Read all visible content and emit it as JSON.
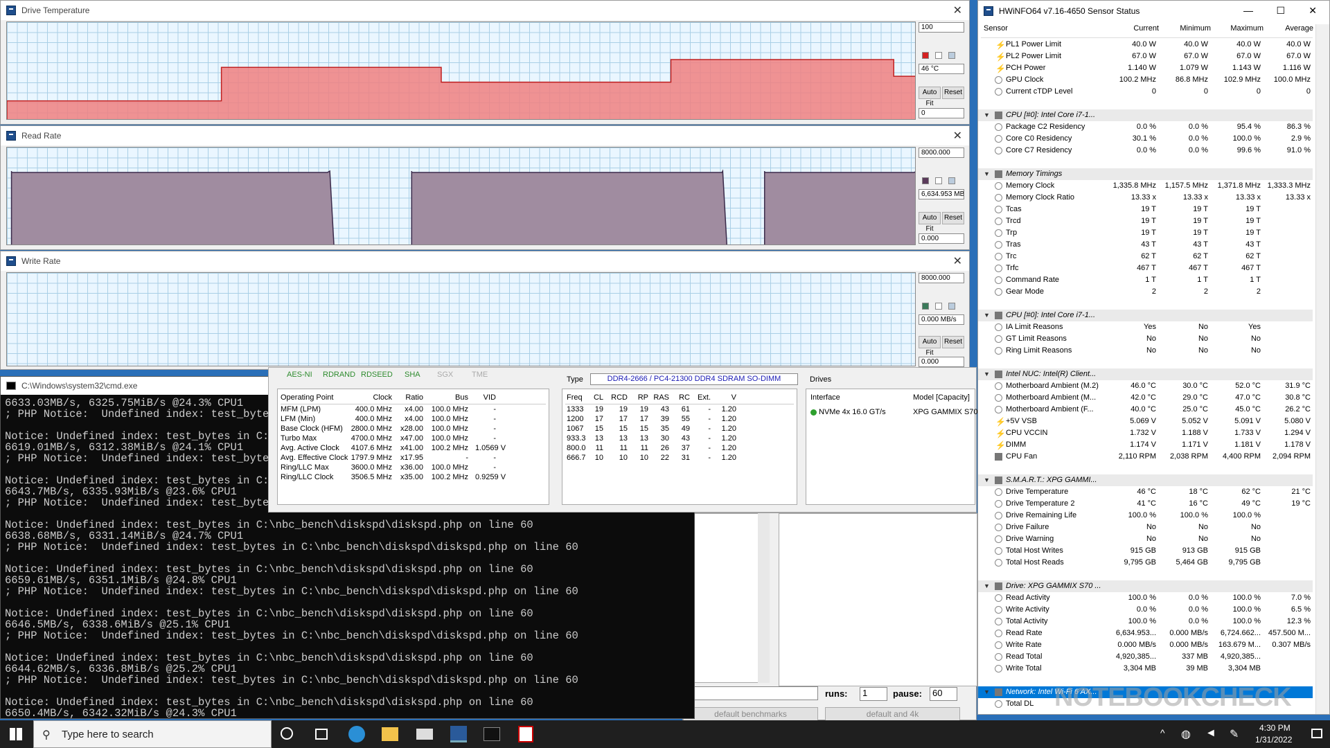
{
  "graphs": [
    {
      "title": "Drive Temperature",
      "max": "100",
      "current": "46 °C",
      "min": "0",
      "autofit": "Auto Fit",
      "reset": "Reset",
      "color": "#f08080",
      "legend_color": "#d42020",
      "points": [
        [
          0,
          0.2
        ],
        [
          0.283,
          0.2
        ],
        [
          0.283,
          0.54
        ],
        [
          0.573,
          0.54
        ],
        [
          0.573,
          0.39
        ],
        [
          0.876,
          0.39
        ],
        [
          0.876,
          0.62
        ],
        [
          1.17,
          0.62
        ],
        [
          1.17,
          0.45
        ],
        [
          1.2,
          0.45
        ]
      ]
    },
    {
      "title": "Read Rate",
      "max": "8000.000",
      "current": "6,634.953 MB",
      "min": "0.000",
      "autofit": "Auto Fit",
      "reset": "Reset",
      "color": "#a08ca0",
      "legend_color": "#5a3a5a"
    },
    {
      "title": "Write Rate",
      "max": "8000.000",
      "current": "0.000 MB/s",
      "min": "0.000",
      "autofit": "Auto Fit",
      "reset": "Reset",
      "color": "#e0f0ff",
      "legend_color": "#3a7a5a"
    }
  ],
  "hwinfo": {
    "title": "HWiNFO64 v7.16-4650 Sensor Status",
    "headers": [
      "Sensor",
      "Current",
      "Minimum",
      "Maximum",
      "Average"
    ],
    "rows": [
      {
        "t": "bolt",
        "n": "PL1 Power Limit",
        "v": [
          "40.0 W",
          "40.0 W",
          "40.0 W",
          "40.0 W"
        ]
      },
      {
        "t": "bolt",
        "n": "PL2 Power Limit",
        "v": [
          "67.0 W",
          "67.0 W",
          "67.0 W",
          "67.0 W"
        ]
      },
      {
        "t": "bolt",
        "n": "PCH Power",
        "v": [
          "1.140 W",
          "1.079 W",
          "1.143 W",
          "1.116 W"
        ]
      },
      {
        "t": "r",
        "n": "GPU Clock",
        "v": [
          "100.2 MHz",
          "86.8 MHz",
          "102.9 MHz",
          "100.0 MHz"
        ]
      },
      {
        "t": "r",
        "n": "Current cTDP Level",
        "v": [
          "0",
          "0",
          "0",
          "0"
        ]
      },
      {
        "t": "blank"
      },
      {
        "t": "grp",
        "n": "CPU [#0]: Intel Core i7-1...",
        "v": [
          "",
          "",
          "",
          ""
        ]
      },
      {
        "t": "r",
        "n": "Package C2 Residency",
        "v": [
          "0.0 %",
          "0.0 %",
          "95.4 %",
          "86.3 %"
        ]
      },
      {
        "t": "r",
        "n": "Core C0 Residency",
        "v": [
          "30.1 %",
          "0.0 %",
          "100.0 %",
          "2.9 %"
        ]
      },
      {
        "t": "r",
        "n": "Core C7 Residency",
        "v": [
          "0.0 %",
          "0.0 %",
          "99.6 %",
          "91.0 %"
        ]
      },
      {
        "t": "blank"
      },
      {
        "t": "grp",
        "n": "Memory Timings",
        "v": [
          "",
          "",
          "",
          ""
        ]
      },
      {
        "t": "r",
        "n": "Memory Clock",
        "v": [
          "1,335.8 MHz",
          "1,157.5 MHz",
          "1,371.8 MHz",
          "1,333.3 MHz"
        ]
      },
      {
        "t": "r",
        "n": "Memory Clock Ratio",
        "v": [
          "13.33 x",
          "13.33 x",
          "13.33 x",
          "13.33 x"
        ]
      },
      {
        "t": "r",
        "n": "Tcas",
        "v": [
          "19 T",
          "19 T",
          "19 T",
          ""
        ]
      },
      {
        "t": "r",
        "n": "Trcd",
        "v": [
          "19 T",
          "19 T",
          "19 T",
          ""
        ]
      },
      {
        "t": "r",
        "n": "Trp",
        "v": [
          "19 T",
          "19 T",
          "19 T",
          ""
        ]
      },
      {
        "t": "r",
        "n": "Tras",
        "v": [
          "43 T",
          "43 T",
          "43 T",
          ""
        ]
      },
      {
        "t": "r",
        "n": "Trc",
        "v": [
          "62 T",
          "62 T",
          "62 T",
          ""
        ]
      },
      {
        "t": "r",
        "n": "Trfc",
        "v": [
          "467 T",
          "467 T",
          "467 T",
          ""
        ]
      },
      {
        "t": "r",
        "n": "Command Rate",
        "v": [
          "1 T",
          "1 T",
          "1 T",
          ""
        ]
      },
      {
        "t": "r",
        "n": "Gear Mode",
        "v": [
          "2",
          "2",
          "2",
          ""
        ]
      },
      {
        "t": "blank"
      },
      {
        "t": "grp",
        "n": "CPU [#0]: Intel Core i7-1...",
        "v": [
          "",
          "",
          "",
          ""
        ]
      },
      {
        "t": "r",
        "n": "IA Limit Reasons",
        "v": [
          "Yes",
          "No",
          "Yes",
          ""
        ]
      },
      {
        "t": "r",
        "n": "GT Limit Reasons",
        "v": [
          "No",
          "No",
          "No",
          ""
        ]
      },
      {
        "t": "r",
        "n": "Ring Limit Reasons",
        "v": [
          "No",
          "No",
          "No",
          ""
        ]
      },
      {
        "t": "blank"
      },
      {
        "t": "grp",
        "n": "Intel NUC: Intel(R) Client...",
        "v": [
          "",
          "",
          "",
          ""
        ]
      },
      {
        "t": "r",
        "n": "Motherboard Ambient (M.2)",
        "v": [
          "46.0 °C",
          "30.0 °C",
          "52.0 °C",
          "31.9 °C"
        ]
      },
      {
        "t": "r",
        "n": "Motherboard Ambient (M...",
        "v": [
          "42.0 °C",
          "29.0 °C",
          "47.0 °C",
          "30.8 °C"
        ]
      },
      {
        "t": "r",
        "n": "Motherboard Ambient (F...",
        "v": [
          "40.0 °C",
          "25.0 °C",
          "45.0 °C",
          "26.2 °C"
        ]
      },
      {
        "t": "bolt",
        "n": "+5V VSB",
        "v": [
          "5.069 V",
          "5.052 V",
          "5.091 V",
          "5.080 V"
        ]
      },
      {
        "t": "bolt",
        "n": "CPU VCCIN",
        "v": [
          "1.732 V",
          "1.188 V",
          "1.733 V",
          "1.294 V"
        ]
      },
      {
        "t": "bolt",
        "n": "DIMM",
        "v": [
          "1.174 V",
          "1.171 V",
          "1.181 V",
          "1.178 V"
        ]
      },
      {
        "t": "chip",
        "n": "CPU Fan",
        "v": [
          "2,110 RPM",
          "2,038 RPM",
          "4,400 RPM",
          "2,094 RPM"
        ]
      },
      {
        "t": "blank"
      },
      {
        "t": "grp",
        "n": "S.M.A.R.T.: XPG GAMMI...",
        "v": [
          "",
          "",
          "",
          ""
        ]
      },
      {
        "t": "r",
        "n": "Drive Temperature",
        "v": [
          "46 °C",
          "18 °C",
          "62 °C",
          "21 °C"
        ]
      },
      {
        "t": "r",
        "n": "Drive Temperature 2",
        "v": [
          "41 °C",
          "16 °C",
          "49 °C",
          "19 °C"
        ]
      },
      {
        "t": "r",
        "n": "Drive Remaining Life",
        "v": [
          "100.0 %",
          "100.0 %",
          "100.0 %",
          ""
        ]
      },
      {
        "t": "r",
        "n": "Drive Failure",
        "v": [
          "No",
          "No",
          "No",
          ""
        ]
      },
      {
        "t": "r",
        "n": "Drive Warning",
        "v": [
          "No",
          "No",
          "No",
          ""
        ]
      },
      {
        "t": "r",
        "n": "Total Host Writes",
        "v": [
          "915 GB",
          "913 GB",
          "915 GB",
          ""
        ]
      },
      {
        "t": "r",
        "n": "Total Host Reads",
        "v": [
          "9,795 GB",
          "5,464 GB",
          "9,795 GB",
          ""
        ]
      },
      {
        "t": "blank"
      },
      {
        "t": "grp",
        "n": "Drive: XPG GAMMIX S70 ...",
        "v": [
          "",
          "",
          "",
          ""
        ]
      },
      {
        "t": "r",
        "n": "Read Activity",
        "v": [
          "100.0 %",
          "0.0 %",
          "100.0 %",
          "7.0 %"
        ]
      },
      {
        "t": "r",
        "n": "Write Activity",
        "v": [
          "0.0 %",
          "0.0 %",
          "100.0 %",
          "6.5 %"
        ]
      },
      {
        "t": "r",
        "n": "Total Activity",
        "v": [
          "100.0 %",
          "0.0 %",
          "100.0 %",
          "12.3 %"
        ]
      },
      {
        "t": "r",
        "n": "Read Rate",
        "v": [
          "6,634.953...",
          "0.000 MB/s",
          "6,724.662...",
          "457.500 M..."
        ]
      },
      {
        "t": "r",
        "n": "Write Rate",
        "v": [
          "0.000 MB/s",
          "0.000 MB/s",
          "163.679 M...",
          "0.307 MB/s"
        ]
      },
      {
        "t": "r",
        "n": "Read Total",
        "v": [
          "4,920,385...",
          "337 MB",
          "4,920,385...",
          ""
        ]
      },
      {
        "t": "r",
        "n": "Write Total",
        "v": [
          "3,304 MB",
          "39 MB",
          "3,304 MB",
          ""
        ]
      },
      {
        "t": "blank"
      },
      {
        "t": "sel",
        "n": "Network: Intel Wi-Fi 6 AX...",
        "v": [
          "",
          "",
          "",
          ""
        ]
      },
      {
        "t": "r",
        "n": "Total DL",
        "v": [
          "",
          "",
          "",
          ""
        ]
      }
    ]
  },
  "cmd": {
    "title": "C:\\Windows\\system32\\cmd.exe",
    "lines": [
      "6633.03MB/s, 6325.75MiB/s @24.3% CPU1",
      "; PHP Notice:  Undefined index: test_bytes in C:\\nbc_be",
      "",
      "Notice: Undefined index: test_bytes in C:\\nbc_be",
      "6619.01MB/s, 6312.38MiB/s @24.1% CPU1",
      "; PHP Notice:  Undefined index: test_bytes in C:",
      "",
      "Notice: Undefined index: test_bytes in C:\\nbc_be",
      "6643.7MB/s, 6335.93MiB/s @23.6% CPU1",
      "; PHP Notice:  Undefined index: test_bytes in C:",
      "",
      "Notice: Undefined index: test_bytes in C:\\nbc_bench\\diskspd\\diskspd.php on line 60",
      "6638.68MB/s, 6331.14MiB/s @24.7% CPU1",
      "; PHP Notice:  Undefined index: test_bytes in C:\\nbc_bench\\diskspd\\diskspd.php on line 60",
      "",
      "Notice: Undefined index: test_bytes in C:\\nbc_bench\\diskspd\\diskspd.php on line 60",
      "6659.61MB/s, 6351.1MiB/s @24.8% CPU1",
      "; PHP Notice:  Undefined index: test_bytes in C:\\nbc_bench\\diskspd\\diskspd.php on line 60",
      "",
      "Notice: Undefined index: test_bytes in C:\\nbc_bench\\diskspd\\diskspd.php on line 60",
      "6646.5MB/s, 6338.6MiB/s @25.1% CPU1",
      "; PHP Notice:  Undefined index: test_bytes in C:\\nbc_bench\\diskspd\\diskspd.php on line 60",
      "",
      "Notice: Undefined index: test_bytes in C:\\nbc_bench\\diskspd\\diskspd.php on line 60",
      "6644.62MB/s, 6336.8MiB/s @25.2% CPU1",
      "; PHP Notice:  Undefined index: test_bytes in C:\\nbc_bench\\diskspd\\diskspd.php on line 60",
      "",
      "Notice: Undefined index: test_bytes in C:\\nbc_bench\\diskspd\\diskspd.php on line 60",
      "6650.4MB/s, 6342.32MiB/s @24.3% CPU1"
    ]
  },
  "cpu": {
    "flags": [
      "AES-NI",
      "RDRAND",
      "RDSEED",
      "SHA",
      "SGX",
      "TME"
    ],
    "op_headers": [
      "Operating Point",
      "Clock",
      "Ratio",
      "Bus",
      "VID"
    ],
    "op_rows": [
      [
        "MFM (LPM)",
        "400.0 MHz",
        "x4.00",
        "100.0 MHz",
        "-"
      ],
      [
        "LFM (Min)",
        "400.0 MHz",
        "x4.00",
        "100.0 MHz",
        "-"
      ],
      [
        "Base Clock (HFM)",
        "2800.0 MHz",
        "x28.00",
        "100.0 MHz",
        "-"
      ],
      [
        "Turbo Max",
        "4700.0 MHz",
        "x47.00",
        "100.0 MHz",
        "-"
      ],
      [
        "Avg. Active Clock",
        "4107.6 MHz",
        "x41.00",
        "100.2 MHz",
        "1.0569 V"
      ],
      [
        "Avg. Effective Clock",
        "1797.9 MHz",
        "x17.95",
        "-",
        "-"
      ],
      [
        "Ring/LLC Max",
        "3600.0 MHz",
        "x36.00",
        "100.0 MHz",
        "-"
      ],
      [
        "Ring/LLC Clock",
        "3506.5 MHz",
        "x35.00",
        "100.2 MHz",
        "0.9259 V"
      ]
    ],
    "type_label": "Type",
    "type_value": "DDR4-2666 / PC4-21300 DDR4 SDRAM SO-DIMM",
    "mem_headers": [
      "Freq",
      "CL",
      "RCD",
      "RP",
      "RAS",
      "RC",
      "Ext.",
      "V"
    ],
    "mem_rows": [
      [
        "1333",
        "19",
        "19",
        "19",
        "43",
        "61",
        "-",
        "1.20"
      ],
      [
        "1200",
        "17",
        "17",
        "17",
        "39",
        "55",
        "-",
        "1.20"
      ],
      [
        "1067",
        "15",
        "15",
        "15",
        "35",
        "49",
        "-",
        "1.20"
      ],
      [
        "933.3",
        "13",
        "13",
        "13",
        "30",
        "43",
        "-",
        "1.20"
      ],
      [
        "800.0",
        "11",
        "11",
        "11",
        "26",
        "37",
        "-",
        "1.20"
      ],
      [
        "666.7",
        "10",
        "10",
        "10",
        "22",
        "31",
        "-",
        "1.20"
      ]
    ],
    "drives_label": "Drives",
    "drive_headers": [
      "Interface",
      "Model [Capacity]"
    ],
    "drive_row": [
      "NVMe 4x 16.0 GT/s",
      "XPG GAMMIX S70"
    ]
  },
  "bench": {
    "runs_label": "runs:",
    "runs_value": "1",
    "pause_label": "pause:",
    "pause_value": "60",
    "default_btn": "default benchmarks",
    "default4k_btn": "default and 4k"
  },
  "taskbar": {
    "search_placeholder": "Type here to search",
    "time": "4:30 PM",
    "date": "1/31/2022"
  },
  "watermark": "NOTEBOOKCHECK"
}
